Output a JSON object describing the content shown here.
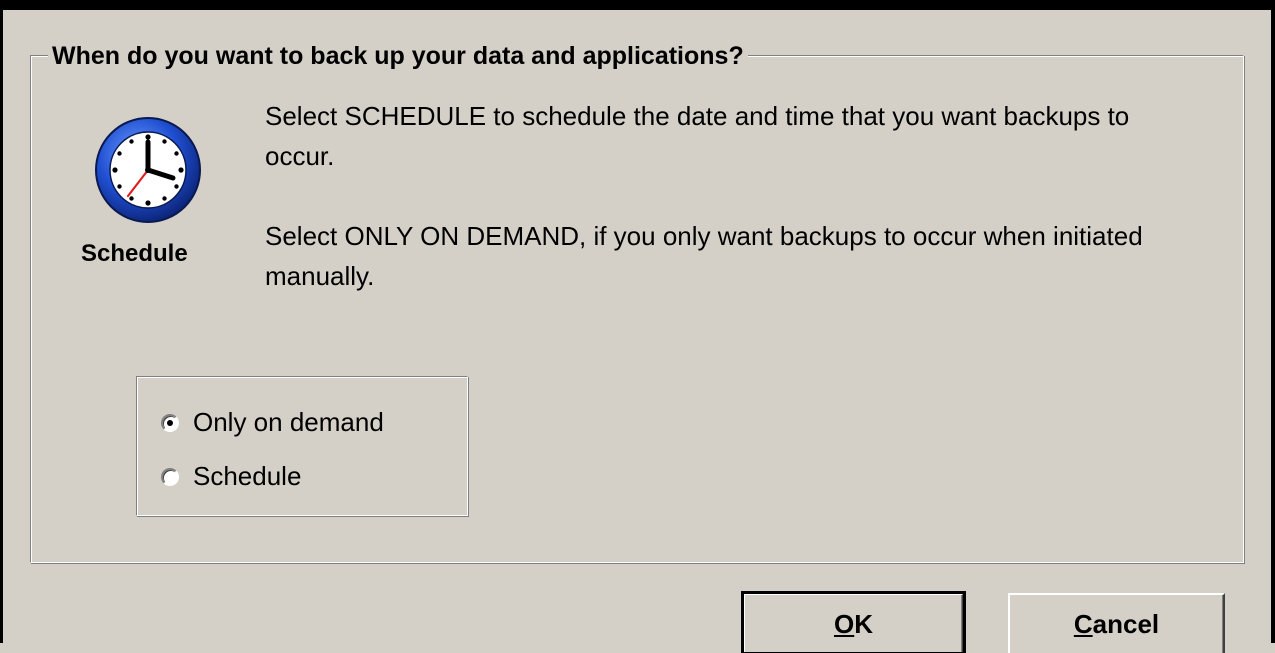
{
  "group": {
    "title": "When do you want to back up your data and applications?"
  },
  "icon": {
    "name": "clock-icon",
    "caption": "Schedule"
  },
  "description": {
    "paragraph1": "Select SCHEDULE to schedule the date and time that you want backups to occur.",
    "paragraph2": "Select ONLY ON DEMAND, if you only want backups to occur when initiated manually."
  },
  "options": [
    {
      "label": "Only on demand",
      "selected": true
    },
    {
      "label": "Schedule",
      "selected": false
    }
  ],
  "buttons": {
    "ok_label": "OK",
    "ok_mnemonic": "O",
    "ok_rest": "K",
    "cancel_label": "Cancel",
    "cancel_mnemonic": "C",
    "cancel_rest": "ancel"
  },
  "colors": {
    "window_bg": "#d4d0c8",
    "clock_ring": "#1f4fd1",
    "clock_hand_second": "#e02020"
  }
}
